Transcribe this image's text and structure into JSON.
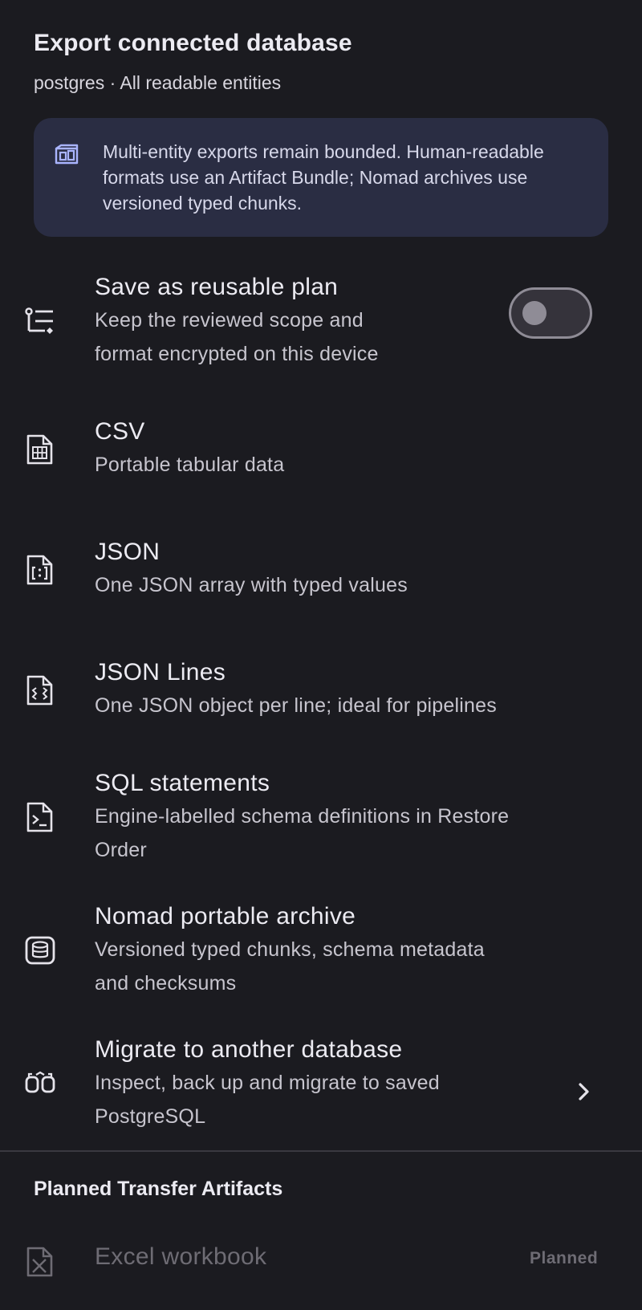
{
  "header": {
    "title": "Export connected database",
    "subtitle": "postgres · All readable entities"
  },
  "banner": {
    "icon": "bundle-icon",
    "text": "Multi-entity exports remain bounded. Human-readable formats use an Artifact Bundle; Nomad archives use versioned typed chunks."
  },
  "save_plan": {
    "icon": "checklist-icon",
    "title": "Save as reusable plan",
    "subtitle_line1": "Keep the reviewed scope and",
    "subtitle_line2": "format encrypted on this device",
    "toggle_on": false
  },
  "formats": [
    {
      "icon": "csv-file-icon",
      "title": "CSV",
      "subtitle_line1": "Portable tabular data"
    },
    {
      "icon": "json-file-icon",
      "title": "JSON",
      "subtitle_line1": "One JSON array with typed values"
    },
    {
      "icon": "jsonl-file-icon",
      "title": "JSON Lines",
      "subtitle_line1": "One JSON object per line; ideal for pipelines"
    },
    {
      "icon": "sql-file-icon",
      "title": "SQL statements",
      "subtitle_line1": "Engine-labelled schema definitions in Restore",
      "subtitle_line2": "Order"
    },
    {
      "icon": "archive-icon",
      "title": "Nomad portable archive",
      "subtitle_line1": "Versioned typed chunks, schema metadata",
      "subtitle_line2": "and checksums"
    },
    {
      "icon": "migrate-icon",
      "title": "Migrate to another database",
      "subtitle_line1": "Inspect, back up and migrate to saved",
      "subtitle_line2": "PostgreSQL"
    }
  ],
  "planned_section": {
    "title": "Planned Transfer Artifacts",
    "items": [
      {
        "icon": "excel-file-icon",
        "title": "Excel workbook",
        "badge": "Planned"
      }
    ]
  },
  "colors": {
    "background": "#1b1b20",
    "banner": "#2a2d43",
    "accent_icon": "#a9b4ff",
    "muted": "#6e6c74"
  }
}
